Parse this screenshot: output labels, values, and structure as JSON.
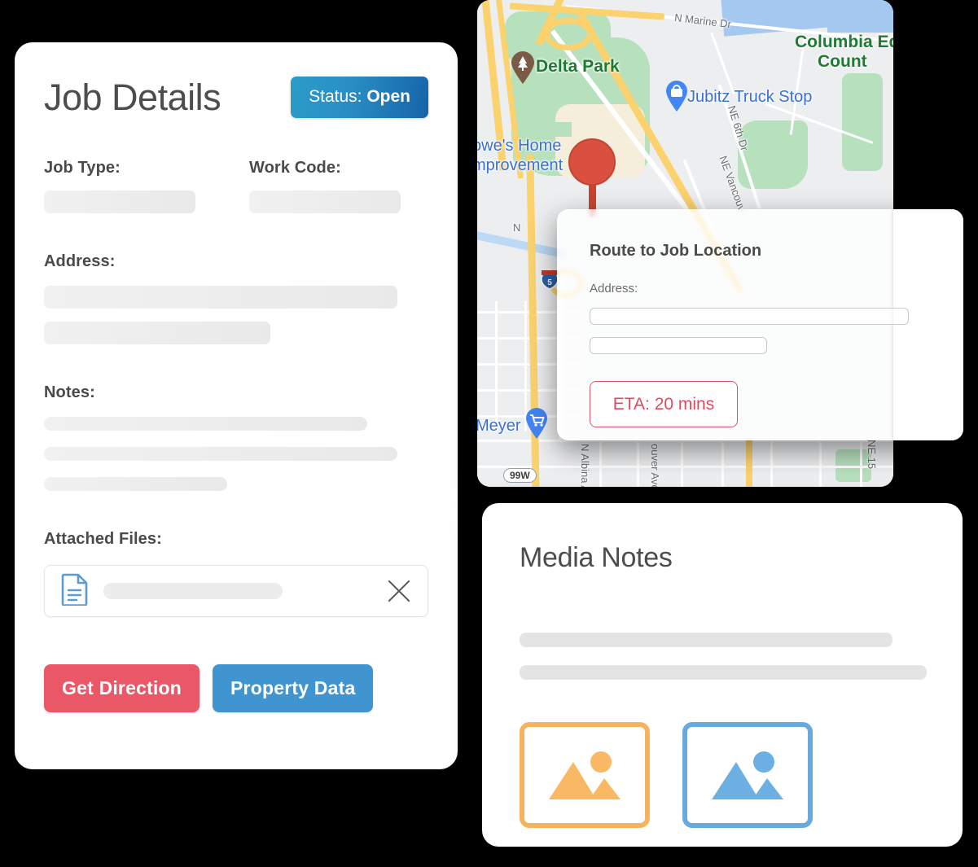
{
  "job_details": {
    "title": "Job Details",
    "status_prefix": "Status:",
    "status_value": "Open",
    "fields": {
      "job_type_label": "Job Type:",
      "work_code_label": "Work Code:",
      "address_label": "Address:",
      "notes_label": "Notes:",
      "attached_files_label": "Attached Files:"
    },
    "buttons": {
      "get_direction": "Get Direction",
      "property_data": "Property Data"
    },
    "colors": {
      "status_badge_from": "#2a9cc9",
      "status_badge_to": "#1664a8",
      "get_direction": "#ea5767",
      "property_data": "#4095d1",
      "file_icon": "#5b9bd5"
    }
  },
  "map": {
    "labels": [
      "N Marine Dr",
      "Delta Park",
      "Jubitz Truck Stop",
      "Columbia Edg",
      "Count",
      "owe's Home",
      "mprovement",
      "NE 6th Dr",
      "NE Vancouv",
      "Meyer",
      "N Albina Ave",
      "ouver Ave",
      "NE 15",
      "N"
    ],
    "shields": [
      "5",
      "99W"
    ],
    "pins": [
      "delta-park-pin",
      "jubitz-pin",
      "meyer-pin",
      "job-location-pin"
    ],
    "colors": {
      "water": "#a5c8f0",
      "park": "#b7e0bc",
      "highway": "#fbd26e",
      "land": "#eceef0",
      "job_pin": "#d9503f"
    }
  },
  "route_popup": {
    "title": "Route to Job Location",
    "address_label": "Address:",
    "eta_label": "ETA: 20 mins",
    "colors": {
      "eta_border": "#d9566a",
      "eta_text": "#e04a5e"
    }
  },
  "media_notes": {
    "title": "Media Notes",
    "thumbnails": [
      {
        "name": "image-thumbnail-orange",
        "color": "#f5b35e"
      },
      {
        "name": "image-thumbnail-blue",
        "color": "#69aade"
      }
    ]
  }
}
